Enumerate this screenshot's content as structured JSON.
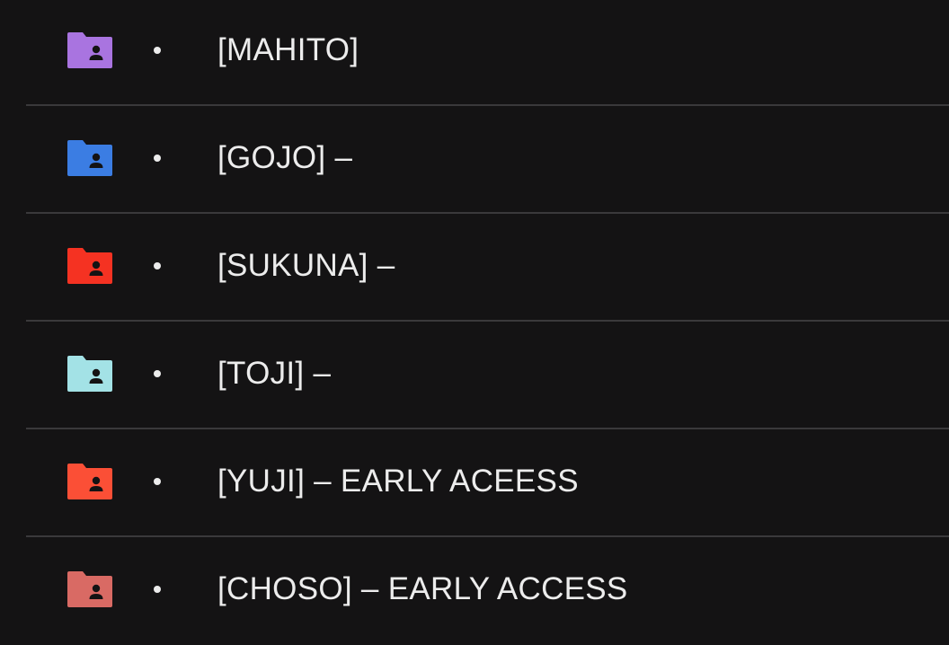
{
  "items": [
    {
      "label": "[MAHITO]",
      "color": "#a974e0",
      "icon": "folder-shared-icon"
    },
    {
      "label": "[GOJO] –",
      "color": "#3b7de3",
      "icon": "folder-shared-icon"
    },
    {
      "label": "[SUKUNA] –",
      "color": "#f53222",
      "icon": "folder-shared-icon"
    },
    {
      "label": "[TOJI] –",
      "color": "#a3e2e6",
      "icon": "folder-shared-icon"
    },
    {
      "label": "[YUJI] – EARLY ACEESS",
      "color": "#fb4f36",
      "icon": "folder-shared-icon"
    },
    {
      "label": "[CHOSO] – EARLY ACCESS",
      "color": "#d96a64",
      "icon": "folder-shared-icon"
    }
  ]
}
